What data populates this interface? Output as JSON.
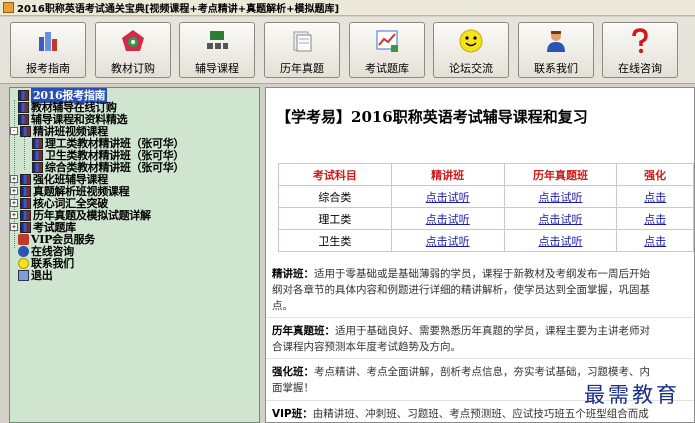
{
  "window": {
    "title": "2016职称英语考试通关宝典[视频课程+考点精讲+真题解析+模拟题库]"
  },
  "toolbar": {
    "buttons": [
      {
        "label": "报考指南",
        "icon": "building-icon"
      },
      {
        "label": "教材订购",
        "icon": "target-icon"
      },
      {
        "label": "辅导课程",
        "icon": "classroom-icon"
      },
      {
        "label": "历年真题",
        "icon": "papers-icon"
      },
      {
        "label": "考试题库",
        "icon": "chart-icon"
      },
      {
        "label": "论坛交流",
        "icon": "smiley-icon"
      },
      {
        "label": "联系我们",
        "icon": "person-icon"
      },
      {
        "label": "在线咨询",
        "icon": "question-icon"
      }
    ]
  },
  "tree": {
    "items": [
      {
        "label": "2016报考指南",
        "selected": true
      },
      {
        "label": "教材辅导在线订购"
      },
      {
        "label": "辅导课程和资料精选"
      },
      {
        "label": "精讲班视频课程",
        "expander": "-"
      },
      {
        "label": "理工类教材精讲班（张可华）"
      },
      {
        "label": "卫生类教材精讲班（张可华）"
      },
      {
        "label": "综合类教材精讲班（张可华）"
      },
      {
        "label": "强化班辅导课程",
        "expander": "+"
      },
      {
        "label": "真题解析班视频课程",
        "expander": "+"
      },
      {
        "label": "核心词汇全突破",
        "expander": "+"
      },
      {
        "label": "历年真题及模拟试题详解",
        "expander": "+"
      },
      {
        "label": "考试题库",
        "expander": "+"
      },
      {
        "label": "VIP会员服务"
      },
      {
        "label": "在线咨询"
      },
      {
        "label": "联系我们"
      },
      {
        "label": "退出"
      }
    ]
  },
  "content": {
    "heading": "【学考易】2016职称英语考试辅导课程和复习",
    "table": {
      "headers": [
        "考试科目",
        "精讲班",
        "历年真题班",
        "强化"
      ],
      "rows": [
        [
          "综合类",
          "点击试听",
          "点击试听",
          "点击"
        ],
        [
          "理工类",
          "点击试听",
          "点击试听",
          "点击"
        ],
        [
          "卫生类",
          "点击试听",
          "点击试听",
          "点击"
        ]
      ]
    },
    "descriptions": [
      {
        "term": "精讲班：",
        "lines": [
          "适用于零基础或是基础薄弱的学员，课程于新教材及考纲发布一周后开始",
          "纲对各章节的具体内容和例题进行详细的精讲解析，使学员达到全面掌握，巩固基",
          "点。"
        ]
      },
      {
        "term": "历年真题班：",
        "lines": [
          "适用于基础良好、需要熟悉历年真题的学员，课程主要为主讲老师对",
          "合课程内容预测本年度考试趋势及方向。"
        ]
      },
      {
        "term": "强化班：",
        "lines": [
          "考点精讲、考点全面讲解，剖析考点信息，夯实考试基础，习题模考、内",
          "面掌握！"
        ]
      },
      {
        "term": "VIP班：",
        "lines": [
          "由精讲班、冲刺班、习题班、考点预测班、应试技巧班五个班型组合而成"
        ]
      }
    ]
  },
  "watermark": "最需教育",
  "colors": {
    "tree_bg": "#cfe5cf",
    "selected": "#2a4fb3",
    "table_header": "#d01818",
    "link": "#1a1aa8"
  }
}
